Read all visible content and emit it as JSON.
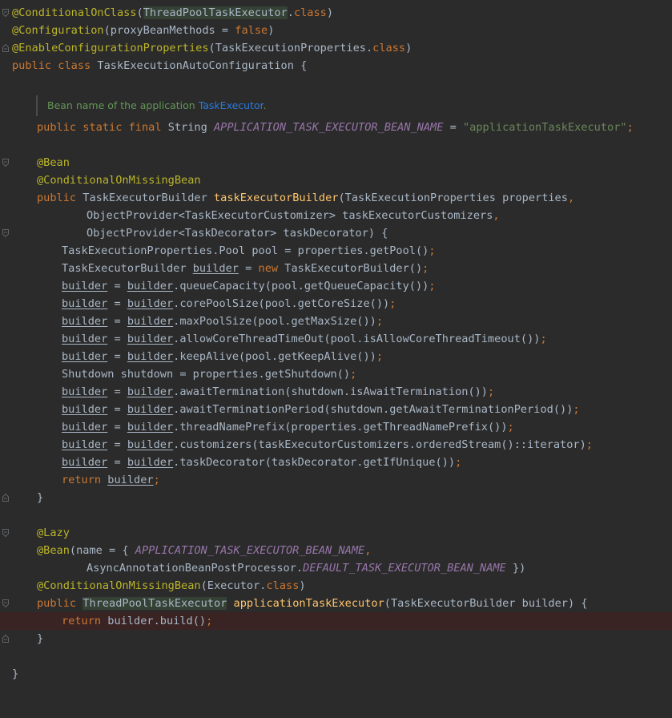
{
  "colors": {
    "background": "#2b2b2b",
    "keyword": "#cc7832",
    "annotation": "#bbb529",
    "string": "#6a8759",
    "method_decl": "#ffc66d",
    "constant": "#9876aa",
    "doc_text": "#629755",
    "doc_link": "#287bde",
    "error_line": "#3a2323"
  },
  "doc_comment": {
    "text": "Bean name of the application ",
    "link": "TaskExecutor",
    "end": "."
  },
  "code": {
    "l1_ann": "@ConditionalOnClass",
    "l1_a": "(",
    "l1_cls": "ThreadPoolTaskExecutor",
    "l1_b": ".",
    "l1_kw": "class",
    "l1_c": ")",
    "l2_ann": "@Configuration",
    "l2_a": "(proxyBeanMethods = ",
    "l2_kw": "false",
    "l2_b": ")",
    "l3_ann": "@EnableConfigurationProperties",
    "l3_a": "(TaskExecutionProperties.",
    "l3_kw": "class",
    "l3_b": ")",
    "l4_kw": "public class ",
    "l4_a": "TaskExecutionAutoConfiguration {",
    "l5_kw": "public static final ",
    "l5_a": "String ",
    "l5_const": "APPLICATION_TASK_EXECUTOR_BEAN_NAME",
    "l5_b": " = ",
    "l5_str": "\"applicationTaskExecutor\"",
    "l5_semi": ";",
    "l6_ann": "@Bean",
    "l7_ann": "@ConditionalOnMissingBean",
    "l8_kw": "public ",
    "l8_a": "TaskExecutorBuilder ",
    "l8_fn": "taskExecutorBuilder",
    "l8_b": "(TaskExecutionProperties properties",
    "l8_c": ",",
    "l9_a": "ObjectProvider<TaskExecutorCustomizer> taskExecutorCustomizers",
    "l9_b": ",",
    "l10_a": "ObjectProvider<TaskDecorator> taskDecorator) {",
    "l11_a": "TaskExecutionProperties.Pool pool = properties.getPool()",
    "l11_semi": ";",
    "l12_a": "TaskExecutorBuilder ",
    "l12_var": "builder",
    "l12_b": " = ",
    "l12_kw": "new ",
    "l12_c": "TaskExecutorBuilder()",
    "l12_semi": ";",
    "var_builder": "builder",
    "assign": " = ",
    "l13_rest": ".queueCapacity(pool.getQueueCapacity())",
    "l14_rest": ".corePoolSize(pool.getCoreSize())",
    "l15_rest": ".maxPoolSize(pool.getMaxSize())",
    "l16_rest": ".allowCoreThreadTimeOut(pool.isAllowCoreThreadTimeout())",
    "l17_rest": ".keepAlive(pool.getKeepAlive())",
    "l18_a": "Shutdown shutdown = properties.getShutdown()",
    "l19_rest": ".awaitTermination(shutdown.isAwaitTermination())",
    "l20_rest": ".awaitTerminationPeriod(shutdown.getAwaitTerminationPeriod())",
    "l21_rest": ".threadNamePrefix(properties.getThreadNamePrefix())",
    "l22_rest": ".customizers(taskExecutorCustomizers.orderedStream()::iterator)",
    "l23_rest": ".taskDecorator(taskDecorator.getIfUnique())",
    "semi": ";",
    "return_kw": "return ",
    "close_brace": "}",
    "l25_ann": "@Lazy",
    "l26_ann": "@Bean",
    "l26_a": "(name = { ",
    "l26_const": "APPLICATION_TASK_EXECUTOR_BEAN_NAME",
    "l26_b": ",",
    "l27_a": "AsyncAnnotationBeanPostProcessor.",
    "l27_const": "DEFAULT_TASK_EXECUTOR_BEAN_NAME",
    "l27_b": " })",
    "l28_ann": "@ConditionalOnMissingBean",
    "l28_a": "(Executor.",
    "l28_kw": "class",
    "l28_b": ")",
    "l29_kw": "public ",
    "l29_cls": "ThreadPoolTaskExecutor",
    "l29_a": " ",
    "l29_fn": "applicationTaskExecutor",
    "l29_b": "(TaskExecutorBuilder builder) {",
    "l30_a": "builder.build()",
    "l30_semi": ";"
  }
}
